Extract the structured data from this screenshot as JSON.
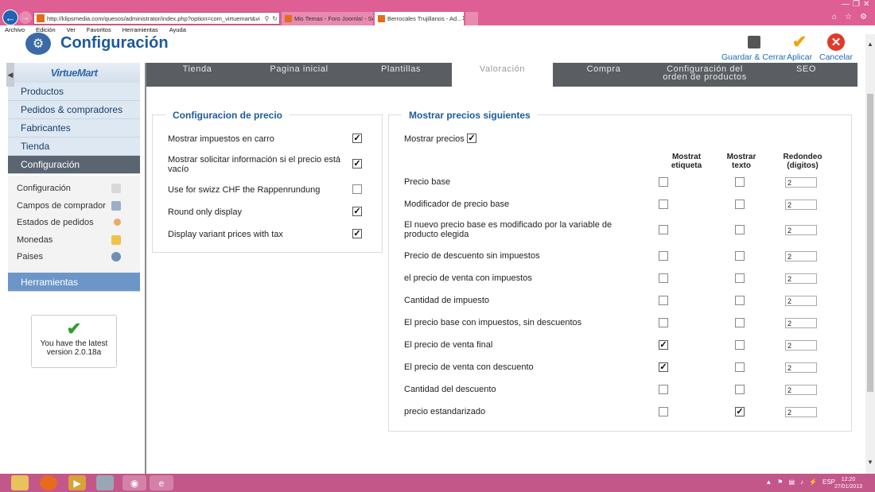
{
  "browser": {
    "url": "http://klipsmedia.com/quesos/administrator/index.php?option=com_virtuemart&vi",
    "tabs": [
      {
        "label": "Mis Temas - Foro Joomla! - Ser..."
      },
      {
        "label": "Berrocales Trujillanos - Ad..."
      }
    ],
    "menu": [
      "Archivo",
      "Edición",
      "Ver",
      "Favoritos",
      "Herramientas",
      "Ayuda"
    ]
  },
  "header": {
    "title": "Configuración",
    "toolbar": {
      "save_close": "Guardar & Cerrar",
      "apply": "Aplicar",
      "cancel": "Cancelar"
    }
  },
  "sidebar": {
    "logo_text": "VirtueMart",
    "menus": [
      "Productos",
      "Pedidos & compradores",
      "Fabricantes",
      "Tienda",
      "Configuración"
    ],
    "active_menu": "Configuración",
    "sub_items": [
      "Configuración",
      "Campos de comprador",
      "Estados de pedidos",
      "Monedas",
      "Paises"
    ],
    "tools_menu": "Herramientas",
    "update_text": "You have the latest version 2.0.18a"
  },
  "config_tabs": [
    "Tienda",
    "Pagina inicial",
    "Plantillas",
    "Valoración",
    "Compra",
    "Configuración del orden de productos",
    "SEO"
  ],
  "active_tab": "Valoración",
  "price_config": {
    "legend": "Configuracion de precio",
    "rows": [
      {
        "label": "Mostrar impuestos en carro",
        "checked": true
      },
      {
        "label": "Mostrar solicitar información si el precio está vacío",
        "checked": true
      },
      {
        "label": "Use for swizz CHF the Rappenrundung",
        "checked": false
      },
      {
        "label": "Round only display",
        "checked": true
      },
      {
        "label": "Display variant prices with tax",
        "checked": true
      }
    ]
  },
  "show_prices": {
    "legend": "Mostrar precios siguientes",
    "show_label": "Mostrar precios",
    "show_checked": true,
    "col_headers": {
      "label": "Mostrat etiqueta",
      "text": "Mostrar texto",
      "round": "Redondeo (digitos)"
    },
    "rows": [
      {
        "label": "Precio base",
        "show_label": false,
        "show_text": false,
        "round": "2"
      },
      {
        "label": "Modificador de precio base",
        "show_label": false,
        "show_text": false,
        "round": "2"
      },
      {
        "label": "El nuevo precio base es modificado por la variable de producto elegida",
        "show_label": false,
        "show_text": false,
        "round": "2"
      },
      {
        "label": "Precio de descuento sin impuestos",
        "show_label": false,
        "show_text": false,
        "round": "2"
      },
      {
        "label": "el precio de venta con impuestos",
        "show_label": false,
        "show_text": false,
        "round": "2"
      },
      {
        "label": "Cantidad de impuesto",
        "show_label": false,
        "show_text": false,
        "round": "2"
      },
      {
        "label": "El precio base con impuestos, sin descuentos",
        "show_label": false,
        "show_text": false,
        "round": "2"
      },
      {
        "label": "El precio de venta final",
        "show_label": true,
        "show_text": false,
        "round": "2"
      },
      {
        "label": "El precio de venta con descuento",
        "show_label": true,
        "show_text": false,
        "round": "2"
      },
      {
        "label": "Cantidad del descuento",
        "show_label": false,
        "show_text": false,
        "round": "2"
      },
      {
        "label": "precio estandarizado",
        "show_label": false,
        "show_text": true,
        "round": "2"
      }
    ]
  },
  "taskbar": {
    "lang": "ESP",
    "time": "12:20",
    "date": "27/01/2013"
  }
}
